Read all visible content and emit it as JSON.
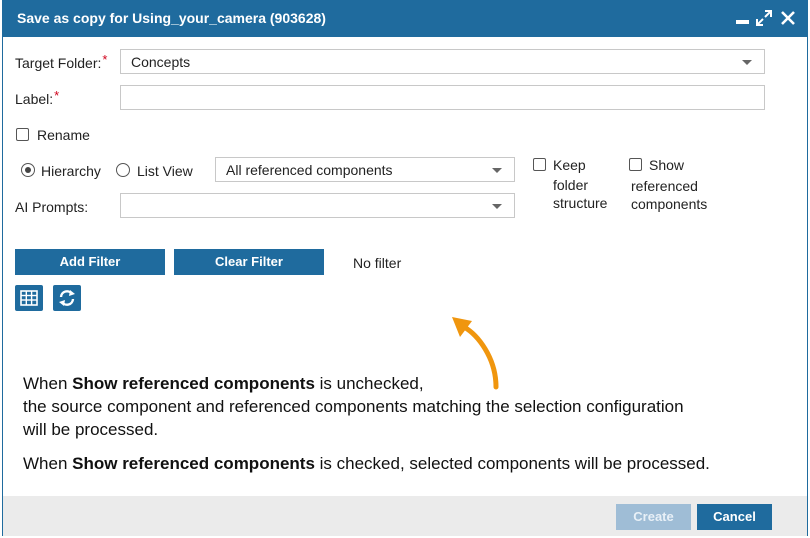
{
  "window": {
    "title": "Save as copy for Using_your_camera (903628)"
  },
  "form": {
    "target_folder_label": "Target Folder:",
    "target_folder_value": "Concepts",
    "label_label": "Label:",
    "label_value": "",
    "required_mark": "*",
    "rename_label": "Rename",
    "rename_checked": false,
    "hierarchy_label": "Hierarchy",
    "hierarchy_selected": true,
    "list_view_label": "List View",
    "scope_value": "All referenced components",
    "keep_folder_label_1": "Keep",
    "keep_folder_label_2": "folder",
    "keep_folder_label_3": "structure",
    "show_ref_label_1": "Show",
    "show_ref_label_2": "referenced",
    "show_ref_label_3": "components",
    "ai_prompts_label": "AI Prompts:",
    "ai_prompts_value": ""
  },
  "filter": {
    "add_label": "Add Filter",
    "clear_label": "Clear Filter",
    "status": "No filter"
  },
  "note": {
    "p1_a": "When ",
    "p1_b": "Show referenced components",
    "p1_c": " is unchecked,",
    "p1_line2": "the source component and referenced components matching the selection configuration",
    "p1_line3": "will be processed.",
    "p2_a": "When ",
    "p2_b": "Show referenced components",
    "p2_c": " is checked, selected components will be processed."
  },
  "footer": {
    "create_label": "Create",
    "cancel_label": "Cancel"
  },
  "icons": {
    "table": "table-view-icon",
    "refresh": "refresh-icon",
    "arrow": "curved-arrow-icon"
  },
  "colors": {
    "primary": "#1f6b9e",
    "required": "#d0021b",
    "arrow": "#f0960e",
    "disabled": "#9fbdd6"
  }
}
